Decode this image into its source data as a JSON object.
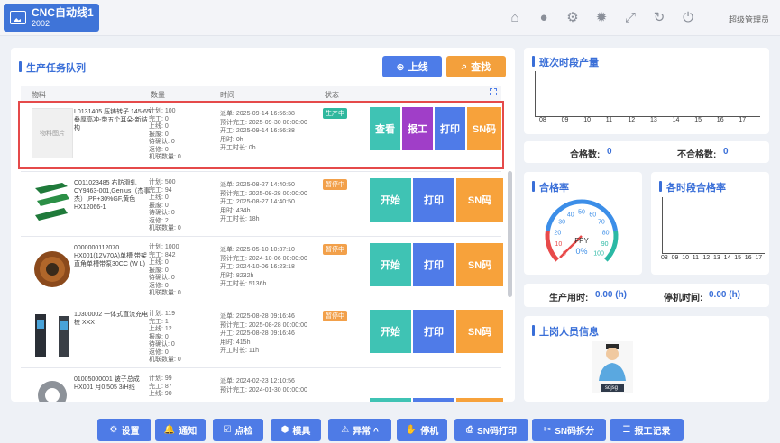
{
  "app": {
    "title": "CNC自动线1",
    "subtitle": "2002"
  },
  "header": {
    "icons": [
      "home-icon",
      "user-icon",
      "gear-icon",
      "sun-icon",
      "expand-icon",
      "refresh-icon",
      "power-icon"
    ],
    "user": "超级管理员"
  },
  "tasks": {
    "title": "生产任务队列",
    "btn_online": "上线",
    "btn_search": "查找",
    "columns": [
      "物料",
      "数量",
      "时间",
      "状态"
    ],
    "rows": [
      {
        "image_label": "物料图片",
        "material": "L0131405 压铸转子 145-65叠厚高冲-带五个耳朵-新结构",
        "qty": [
          "计划: 100",
          "完工: 0",
          "上线: 0",
          "报废: 0",
          "待确认: 0",
          "返修: 0",
          "机联数量: 0"
        ],
        "time": [
          "派单: 2025-09-14 16:56:38",
          "预计完工: 2025-09-30 00:00:00",
          "开工: 2025-09-14 16:56:38",
          "用时: 0h",
          "开工时长: 0h"
        ],
        "status": "生产中",
        "actions": [
          "查看",
          "报工",
          "打印",
          "SN码"
        ]
      },
      {
        "material": "C011023485 右防滑轧 CY9463-001,Genius（杰事杰）,PP+30%GF,黄色 HX12066-1",
        "qty": [
          "计划: 500",
          "完工: 94",
          "上线: 0",
          "报废: 0",
          "待确认: 0",
          "返修: 2",
          "机联数量: 0"
        ],
        "time": [
          "派单: 2025-08-27 14:40:50",
          "预计完工: 2025-08-28 00:00:00",
          "开工: 2025-08-27 14:40:50",
          "用时: 434h",
          "开工时长: 18h"
        ],
        "status": "暂停中",
        "actions": [
          "开始",
          "打印",
          "SN码"
        ]
      },
      {
        "material": "0000000112070 HX001(12V70A)单槽 带架 直角单槽带泵30CC (W L)",
        "qty": [
          "计划: 1000",
          "完工: 842",
          "上线: 0",
          "报废: 0",
          "待确认: 0",
          "返修: 0",
          "机联数量: 0"
        ],
        "time": [
          "派单: 2025-05-10 10:37:10",
          "预计完工: 2024-10-06 00:00:00",
          "开工: 2024-10-06 16:23:18",
          "用时: 8232h",
          "开工时长: 5136h"
        ],
        "status": "暂停中",
        "actions": [
          "开始",
          "打印",
          "SN码"
        ]
      },
      {
        "material": "10300002 一体式直流充电桩 XXX",
        "qty": [
          "计划: 119",
          "完工: 1",
          "上线: 12",
          "报废: 0",
          "待确认: 0",
          "返修: 0",
          "机联数量: 0"
        ],
        "time": [
          "派单: 2025-08-28 09:16:46",
          "预计完工: 2025-08-28 00:00:00",
          "开工: 2025-08-28 09:16:46",
          "用时: 415h",
          "开工时长: 11h"
        ],
        "status": "暂停中",
        "actions": [
          "开始",
          "打印",
          "SN码"
        ]
      },
      {
        "material": "01005000001 铍子总成HX001 月0.505 3/H线",
        "qty": [
          "计划: 99",
          "完工: 87",
          "上线: 90"
        ],
        "time": [
          "派单: 2024-02-23 12:10:56",
          "预计完工: 2024-01-30 00:00:00"
        ],
        "status": "",
        "actions": []
      }
    ]
  },
  "shift_output": {
    "title": "班次时段产量",
    "hours": [
      "08",
      "09",
      "10",
      "11",
      "12",
      "13",
      "14",
      "15",
      "16",
      "17"
    ]
  },
  "quality": {
    "pass_label": "合格数:",
    "pass_value": "0",
    "fail_label": "不合格数:",
    "fail_value": "0"
  },
  "pass_rate": {
    "title": "合格率",
    "gauge_ticks": [
      "0",
      "10",
      "20",
      "30",
      "40",
      "50",
      "60",
      "70",
      "80",
      "90",
      "100"
    ],
    "gauge_unit": "FPY",
    "gauge_value": "0%",
    "fraction": 0
  },
  "hourly_rate": {
    "title": "各时段合格率",
    "hours": [
      "08",
      "09",
      "10",
      "11",
      "12",
      "13",
      "14",
      "15",
      "16",
      "17"
    ]
  },
  "times": {
    "run_label": "生产用时:",
    "run_value": "0.00 (h)",
    "stop_label": "停机时间:",
    "stop_value": "0.00 (h)"
  },
  "staff": {
    "title": "上岗人员信息",
    "badge": "sqjsg"
  },
  "bottom": [
    {
      "icon": "⚙",
      "label": "设置"
    },
    {
      "icon": "🔔",
      "label": "通知"
    },
    {
      "icon": "☑",
      "label": "点检"
    },
    {
      "icon": "⬢",
      "label": "模具"
    },
    {
      "icon": "⚠",
      "label": "异常 ^"
    },
    {
      "icon": "✋",
      "label": "停机"
    },
    {
      "icon": "⎙",
      "label": "SN码打印"
    },
    {
      "icon": "✂",
      "label": "SN码拆分"
    },
    {
      "icon": "☰",
      "label": "报工记录"
    }
  ]
}
